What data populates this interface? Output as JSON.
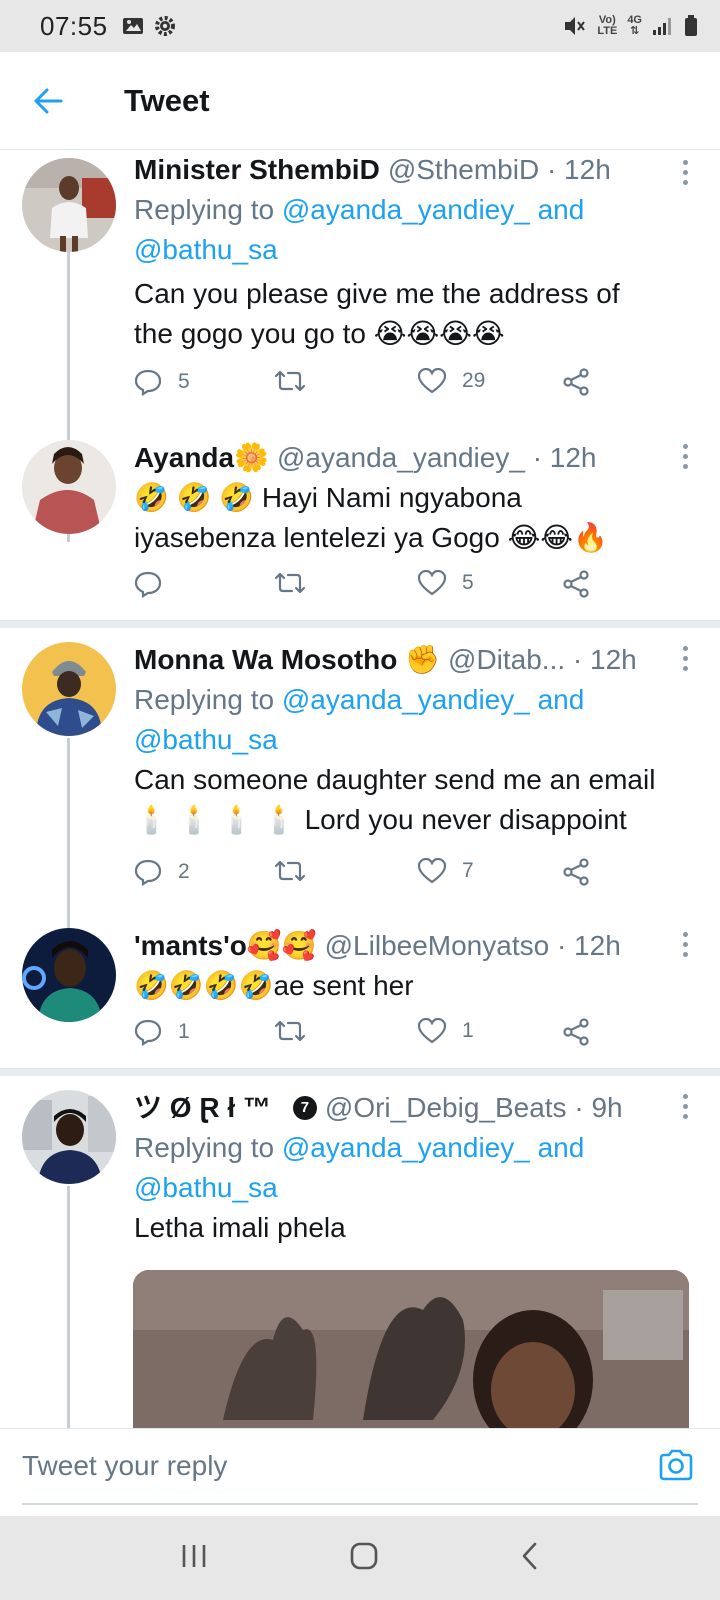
{
  "status_bar": {
    "time": "07:55",
    "network_label_top": "Vo)",
    "network_label_bottom": "LTE",
    "data_type": "4G"
  },
  "header": {
    "title": "Tweet"
  },
  "tweets": [
    {
      "name": "Minister SthembiD",
      "handle": "@SthembiD · 12h",
      "replying_prefix": "Replying to",
      "replying_user1": "@ayanda_yandiey_",
      "replying_and": "and",
      "replying_user2": "@bathu_sa",
      "text": "Can you please give me the address of the gogo you go to 😭😭😭😭",
      "replies": "5",
      "retweets": "",
      "likes": "29"
    },
    {
      "name": "Ayanda🌼",
      "handle": "@ayanda_yandiey_ · 12h",
      "text": "🤣 🤣 🤣 Hayi Nami ngyabona iyasebenza lentelezi ya Gogo 😂😂🔥",
      "replies": "",
      "retweets": "",
      "likes": "5"
    },
    {
      "name": "Monna Wa Mosotho ✊",
      "handle": "@Ditab... · 12h",
      "replying_prefix": "Replying to",
      "replying_user1": "@ayanda_yandiey_",
      "replying_and": "and",
      "replying_user2": "@bathu_sa",
      "text_line1": "Can someone daughter send me an email",
      "text_line2": "🕯️ 🕯️ 🕯️ 🕯️  Lord you never disappoint",
      "replies": "2",
      "retweets": "",
      "likes": "7"
    },
    {
      "name": "'mants'o🥰🥰",
      "handle": "@LilbeeMonyatso · 12h",
      "text": "🤣🤣🤣🤣ae sent her",
      "replies": "1",
      "retweets": "",
      "likes": "1"
    },
    {
      "name": "ツ Ø Ɽ ł ™",
      "badge": "7",
      "handle": "@Ori_Debig_Beats · 9h",
      "replying_prefix": "Replying to",
      "replying_user1": "@ayanda_yandiey_",
      "replying_and": "and",
      "replying_user2": "@bathu_sa",
      "text": "Letha imali phela"
    }
  ],
  "composer": {
    "placeholder": "Tweet your reply"
  },
  "colors": {
    "accent": "#1da1f2",
    "muted": "#657786",
    "text": "#14171a"
  },
  "icons": [
    "back-arrow-icon",
    "reply-icon",
    "retweet-icon",
    "like-icon",
    "share-icon",
    "more-icon",
    "camera-icon",
    "recent-apps-icon",
    "home-icon",
    "back-nav-icon"
  ]
}
